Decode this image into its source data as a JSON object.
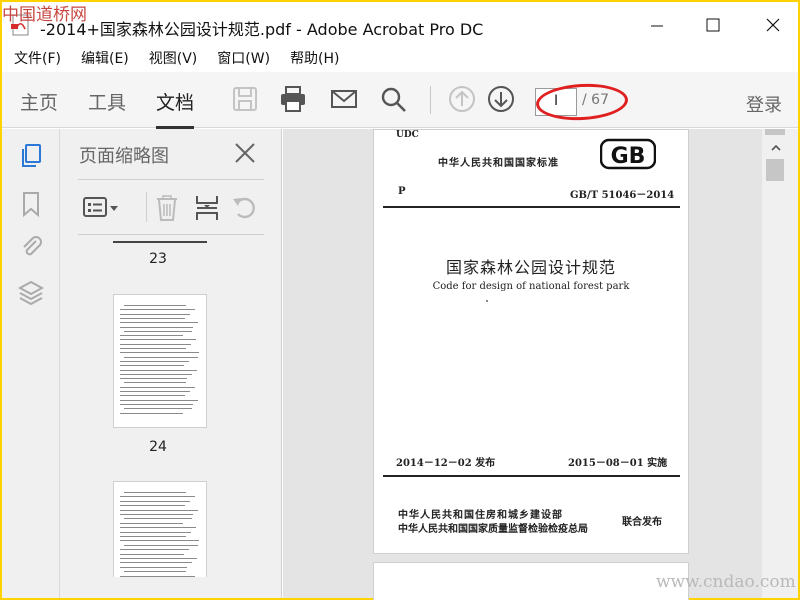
{
  "window": {
    "title": "-2014+国家森林公园设计规范.pdf - Adobe Acrobat Pro DC"
  },
  "menu": [
    "文件(F)",
    "编辑(E)",
    "视图(V)",
    "窗口(W)",
    "帮助(H)"
  ],
  "toolbar": {
    "tab_home": "主页",
    "tab_tools": "工具",
    "tab_document": "文档",
    "page_current": "I",
    "page_total": "/ 67",
    "signin": "登录"
  },
  "thumb_panel": {
    "title": "页面缩略图",
    "pages": [
      "23",
      "24"
    ]
  },
  "document": {
    "udc": "UDC",
    "standard_org": "中华人民共和国国家标准",
    "logo_text": "GB",
    "class_code": "P",
    "standard_number": "GB/T 51046－2014",
    "title_cn": "国家森林公园设计规范",
    "title_en": "Code for design of national forest park",
    "publish_date": "2014－12－02  发布",
    "implement_date": "2015－08－01  实施",
    "issuer_1": "中华人民共和国住房和城乡建设部",
    "issuer_2": "中华人民共和国国家质量监督检验检疫总局",
    "joint_issue": "联合发布"
  },
  "watermark": {
    "top": "中国道桥网",
    "bottom": "www.cndao.com"
  },
  "colors": {
    "accent_blue": "#2b78d6",
    "annotation_red": "#e02020",
    "frame_yellow": "#ffd200"
  }
}
